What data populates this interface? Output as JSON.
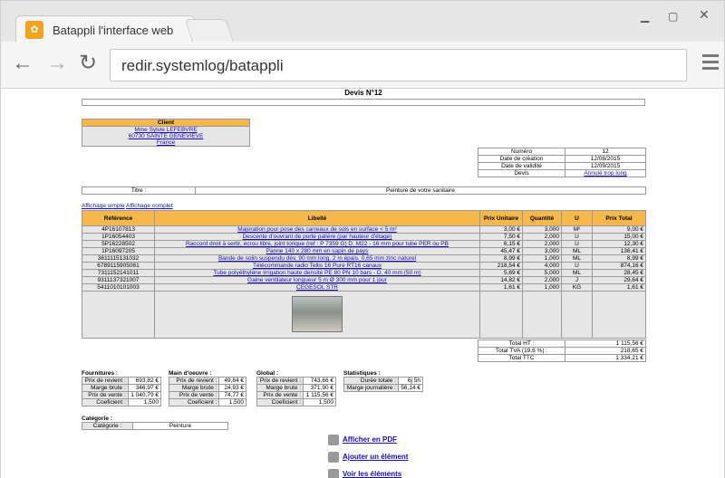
{
  "browser": {
    "tab_title": "Batappli l'interface web",
    "url": "redir.systemlog/batappli"
  },
  "title": "Devis N°12",
  "client": {
    "header": "Client",
    "name": "Mme Sylvie LEFEBVRE",
    "city": "60730 SAINTE GENEVIEVE",
    "country": "France"
  },
  "info": [
    {
      "label": "Numéro",
      "value": "12"
    },
    {
      "label": "Date de création",
      "value": "12/08/2015"
    },
    {
      "label": "Date de validité",
      "value": "12/09/2015"
    },
    {
      "label": "Devis",
      "value": "Annulé trop long"
    }
  ],
  "titre": {
    "label": "Titre :",
    "value": "Peinture de votre sanitaire"
  },
  "display_links": {
    "simple": "Affichage simple",
    "complet": "Affichage complet"
  },
  "table": {
    "headers": [
      "Référence",
      "Libellé",
      "Prix Unitaire",
      "Quantité",
      "U",
      "Prix Total"
    ],
    "rows": [
      [
        "4P16107813",
        "Majoration pour pose des carreaux de sols en surface < 5 m²",
        "3,00 €",
        "3,000",
        "M²",
        "9,00 €"
      ],
      [
        "1P16054403",
        "Descente d'ouvrant de porte palière (par hauteur d'étage)",
        "7,50 €",
        "2,000",
        "U",
        "15,00 €"
      ],
      [
        "5P16228502",
        "Raccord droit à sertir, écrou libre, joint torique (ref : P 7359 G) D. M22 - 16 mm pour tube PER ou PB",
        "6,15 €",
        "2,000",
        "U",
        "12,30 €"
      ],
      [
        "1P16097205",
        "Panne 140 x 280 mm en sapin de pays",
        "45,47 €",
        "3,000",
        "ML",
        "136,41 €"
      ],
      [
        "3611115131032",
        "Bande de solin suspendu dév. 90 mm long. 2 m épais. 0,65 mm zinc naturel",
        "8,99 €",
        "1,000",
        "ML",
        "8,99 €"
      ],
      [
        "6789115905061",
        "Télécommande radio Tellis 16 Pure RT16 canaux",
        "218,54 €",
        "4,000",
        "U",
        "874,16 €"
      ],
      [
        "7311152141011",
        "Tube polyéthylène Irrigation haute densité PE 80 PN 10 bars - D. 40 mm (50 m)",
        "5,69 €",
        "5,000",
        "ML",
        "28,45 €"
      ],
      [
        "9311137321007",
        "Gaine ventilateur longueur 5 m Ø 300 mm pour 1 jour",
        "14,82 €",
        "2,000",
        "J",
        "29,64 €"
      ],
      [
        "5411010101003",
        "CEGESOL STR",
        "1,61 €",
        "1,000",
        "KG",
        "1,61 €"
      ]
    ]
  },
  "totals": [
    {
      "label": "Total HT :",
      "value": "1 115,56 €"
    },
    {
      "label": "Total TVA (19,6 %) :",
      "value": "218,65 €"
    },
    {
      "label": "Total TTC",
      "value": "1 334,21 €"
    }
  ],
  "fournitures": {
    "title": "Fournitures :",
    "rows": [
      [
        "Prix de revient :",
        "693,82 €"
      ],
      [
        "Marge brute :",
        "346,97 €"
      ],
      [
        "Prix de vente :",
        "1 040,79 €"
      ],
      [
        "Coeficient :",
        "1,500"
      ]
    ]
  },
  "main_oeuvre": {
    "title": "Main d'oeuvre :",
    "rows": [
      [
        "Prix de revient :",
        "49,84 €"
      ],
      [
        "Marge brute :",
        "24,93 €"
      ],
      [
        "Prix de vente :",
        "74,77 €"
      ],
      [
        "Coeficient :",
        "1,500"
      ]
    ]
  },
  "global": {
    "title": "Global :",
    "rows": [
      [
        "Prix de revient :",
        "743,66 €"
      ],
      [
        "Marge brute :",
        "371,90 €"
      ],
      [
        "Prix de vente :",
        "1 115,56 €"
      ],
      [
        "Coeficient :",
        "1,500"
      ]
    ]
  },
  "statistiques": {
    "title": "Statistiques :",
    "rows": [
      [
        "Durée totale :",
        "6j 5h"
      ],
      [
        "Marge journalière :",
        "56,14 €"
      ]
    ]
  },
  "categorie": {
    "title": "Catégorie :",
    "label": "Catégorie :",
    "value": "Peinture"
  },
  "actions": [
    "Afficher en PDF",
    "Ajouter un élément",
    "Voir les éléments"
  ],
  "colors": {
    "header_orange": "#f6b84a",
    "grey_row": "#e6e6e6",
    "link": "#1a0dab"
  }
}
